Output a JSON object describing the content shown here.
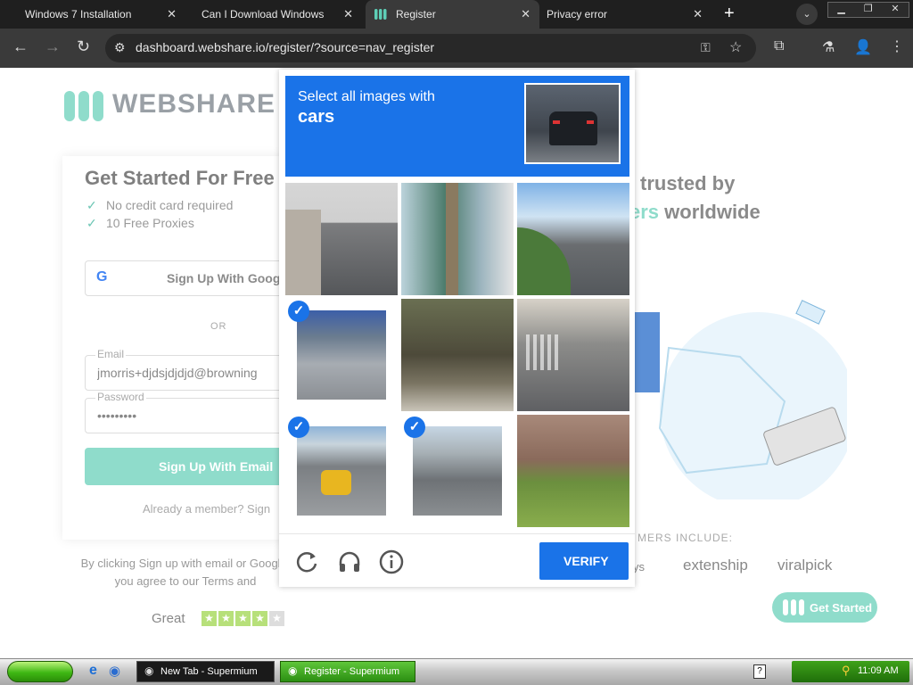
{
  "browser": {
    "tabs": [
      {
        "label": "Windows 7 Installation"
      },
      {
        "label": "Can I Download Windows"
      },
      {
        "label": "Register"
      },
      {
        "label": "Privacy error"
      }
    ],
    "url": "dashboard.webshare.io/register/?source=nav_register"
  },
  "page": {
    "logo": "WEBSHARE",
    "title": "Get Started For Free",
    "features": [
      "No credit card required",
      "10 Free Proxies"
    ],
    "google_button": "Sign Up With Google",
    "or": "OR",
    "email_label": "Email",
    "email_value": "jmorris+djdsjdjdjd@browning",
    "password_label": "Password",
    "password_value": "•••••••••",
    "signup_button": "Sign Up With Email",
    "already": "Already a member? Sign",
    "terms": "By clicking Sign up with email or Google, you agree to our Terms and",
    "terms_link": "Terms",
    "rating_label": "Great",
    "trusted_line1": "trusted by",
    "trusted_line2_accent": "ers",
    "trusted_line2": "worldwide",
    "customers_label": "MERS INCLUDE:",
    "customer_logos": [
      "ys",
      "extenship",
      "viralpick"
    ],
    "get_started": "Get Started"
  },
  "captcha": {
    "instruction": "Select all images with",
    "target": "cars",
    "selected_tiles": [
      3,
      6,
      7
    ],
    "verify": "VERIFY"
  },
  "taskbar": {
    "tasks": [
      {
        "label": "New Tab - Supermium"
      },
      {
        "label": "Register - Supermium"
      }
    ],
    "clock": "11:09 AM"
  }
}
